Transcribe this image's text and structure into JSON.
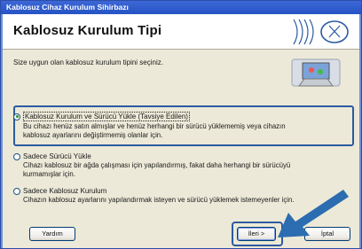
{
  "window": {
    "title": "Kablosuz Cihaz Kurulum Sihirbazı"
  },
  "header": {
    "title": "Kablosuz Kurulum Tipi"
  },
  "instruction": "Size uygun olan kablosuz kurulum tipini seçiniz.",
  "options": [
    {
      "label": "Kablosuz Kurulum ve Sürücü Yükle (Tavsiye Edilen)",
      "desc1": "Bu cihazı henüz satın almışlar ve henüz herhangi bir sürücü yüklememiş veya cihazın",
      "desc2": "kablosuz ayarlarını değiştirmemiş olanlar için.",
      "selected": true
    },
    {
      "label": "Sadece Sürücü Yükle",
      "desc1": "Cihazı kablosuz bir ağda çalışması için yapılandırmış, fakat daha herhangi bir sürücüyü",
      "desc2": "kurmamışlar için.",
      "selected": false
    },
    {
      "label": "Sadece Kablosuz Kurulum",
      "desc1": "Cihazın kablosuz ayarlarını yapılandırmak isteyen ve sürücü yüklemek istemeyenler için.",
      "selected": false
    }
  ],
  "buttons": {
    "help": "Yardım",
    "next": "İleri >",
    "cancel": "İptal"
  },
  "colors": {
    "titlebar": "#2554c4",
    "highlight": "#2c5aa0",
    "arrow": "#2c6cb0"
  }
}
